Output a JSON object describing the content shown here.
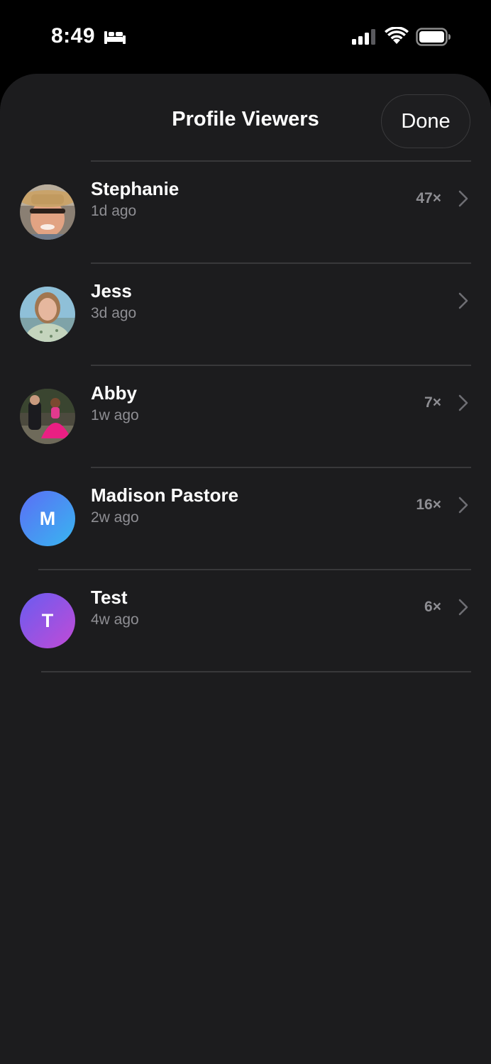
{
  "status_bar": {
    "time": "8:49",
    "icons": [
      "bed-icon",
      "cellular-signal-icon",
      "wifi-icon",
      "battery-icon"
    ]
  },
  "sheet": {
    "title": "Profile Viewers",
    "done_label": "Done"
  },
  "viewers": [
    {
      "name": "Stephanie",
      "when": "1d ago",
      "count": "47×",
      "avatar": "photo"
    },
    {
      "name": "Jess",
      "when": "3d ago",
      "count": "",
      "avatar": "photo"
    },
    {
      "name": "Abby",
      "when": "1w ago",
      "count": "7×",
      "avatar": "photo"
    },
    {
      "name": "Madison Pastore",
      "when": "2w ago",
      "count": "16×",
      "avatar_letter": "M",
      "avatar_colors": [
        "#5b6ef5",
        "#38b6f0"
      ]
    },
    {
      "name": "Test",
      "when": "4w ago",
      "count": "6×",
      "avatar_letter": "T",
      "avatar_colors": [
        "#6a5cf0",
        "#c14bd6"
      ]
    }
  ],
  "colors": {
    "sheet_bg": "#1c1c1e",
    "secondary_text": "#8e8e93",
    "divider": "#38383a"
  }
}
